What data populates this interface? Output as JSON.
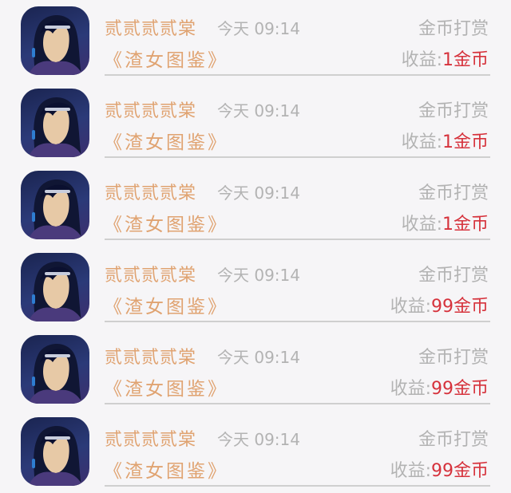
{
  "rows": [
    {
      "name": "贰贰贰贰棠",
      "time": "今天 09:14",
      "type": "金币打赏",
      "book": "《渣女图鉴》",
      "earn_label": "收益:",
      "amount": "1金币"
    },
    {
      "name": "贰贰贰贰棠",
      "time": "今天 09:14",
      "type": "金币打赏",
      "book": "《渣女图鉴》",
      "earn_label": "收益:",
      "amount": "1金币"
    },
    {
      "name": "贰贰贰贰棠",
      "time": "今天 09:14",
      "type": "金币打赏",
      "book": "《渣女图鉴》",
      "earn_label": "收益:",
      "amount": "1金币"
    },
    {
      "name": "贰贰贰贰棠",
      "time": "今天 09:14",
      "type": "金币打赏",
      "book": "《渣女图鉴》",
      "earn_label": "收益:",
      "amount": "99金币"
    },
    {
      "name": "贰贰贰贰棠",
      "time": "今天 09:14",
      "type": "金币打赏",
      "book": "《渣女图鉴》",
      "earn_label": "收益:",
      "amount": "99金币"
    },
    {
      "name": "贰贰贰贰棠",
      "time": "今天 09:14",
      "type": "金币打赏",
      "book": "《渣女图鉴》",
      "earn_label": "收益:",
      "amount": "99金币"
    }
  ],
  "colors": {
    "name": "#e0a371",
    "muted": "#b3b3b3",
    "amount": "#d6323c",
    "divider": "#cfcfcf",
    "background": "#f6f5f7"
  },
  "icons": {
    "avatar": "user-avatar-anime-portrait"
  }
}
